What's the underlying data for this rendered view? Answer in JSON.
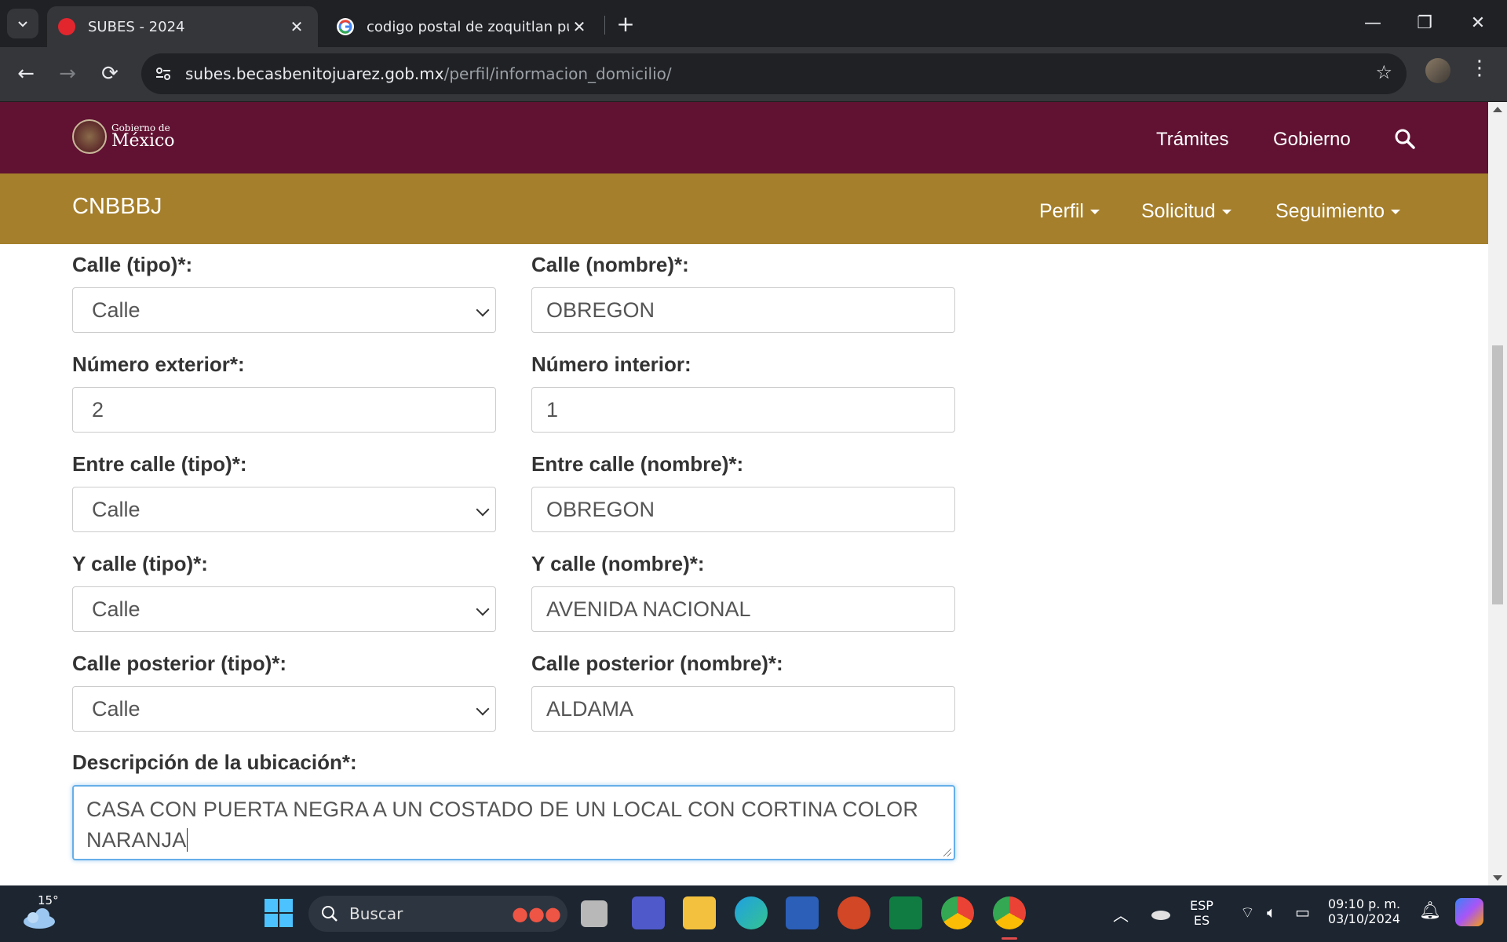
{
  "browser": {
    "tabs": [
      {
        "title": "SUBES - 2024",
        "favicon_color": "#e3262e",
        "active": true
      },
      {
        "title": "codigo postal de zoquitlan puebla",
        "favicon_color": "#ffffff",
        "active": false
      }
    ],
    "url_host": "subes.becasbenitojuarez.gob.mx",
    "url_path": "/perfil/informacion_domicilio/"
  },
  "gob_header": {
    "logo_small": "Gobierno de",
    "logo_big": "México",
    "nav": [
      "Trámites",
      "Gobierno"
    ]
  },
  "sub_header": {
    "brand": "CNBBBJ",
    "nav": [
      "Perfil",
      "Solicitud",
      "Seguimiento"
    ]
  },
  "form": {
    "calle_tipo": {
      "label": "Calle (tipo)*:",
      "value": "Calle"
    },
    "calle_nombre": {
      "label": "Calle (nombre)*:",
      "value": "OBREGON"
    },
    "numero_exterior": {
      "label": "Número exterior*:",
      "value": "2"
    },
    "numero_interior": {
      "label": "Número interior:",
      "value": "1"
    },
    "entre_calle_tipo": {
      "label": "Entre calle (tipo)*:",
      "value": "Calle"
    },
    "entre_calle_nombre": {
      "label": "Entre calle (nombre)*:",
      "value": "OBREGON"
    },
    "y_calle_tipo": {
      "label": "Y calle (tipo)*:",
      "value": "Calle"
    },
    "y_calle_nombre": {
      "label": "Y calle (nombre)*:",
      "value": "AVENIDA NACIONAL"
    },
    "calle_posterior_tipo": {
      "label": "Calle posterior (tipo)*:",
      "value": "Calle"
    },
    "calle_posterior_nombre": {
      "label": "Calle posterior (nombre)*:",
      "value": "ALDAMA"
    },
    "descripcion": {
      "label": "Descripción de la ubicación*:",
      "value": "CASA CON PUERTA NEGRA A UN COSTADO DE UN LOCAL CON CORTINA COLOR NARANJA"
    }
  },
  "taskbar": {
    "temperature": "15°",
    "search_placeholder": "Buscar",
    "lang_top": "ESP",
    "lang_bottom": "ES",
    "time": "09:10 p. m.",
    "date": "03/10/2024"
  },
  "colors": {
    "gob_primary": "#611232",
    "gob_secondary": "#a57f2c",
    "focus_border": "#66afe9"
  }
}
